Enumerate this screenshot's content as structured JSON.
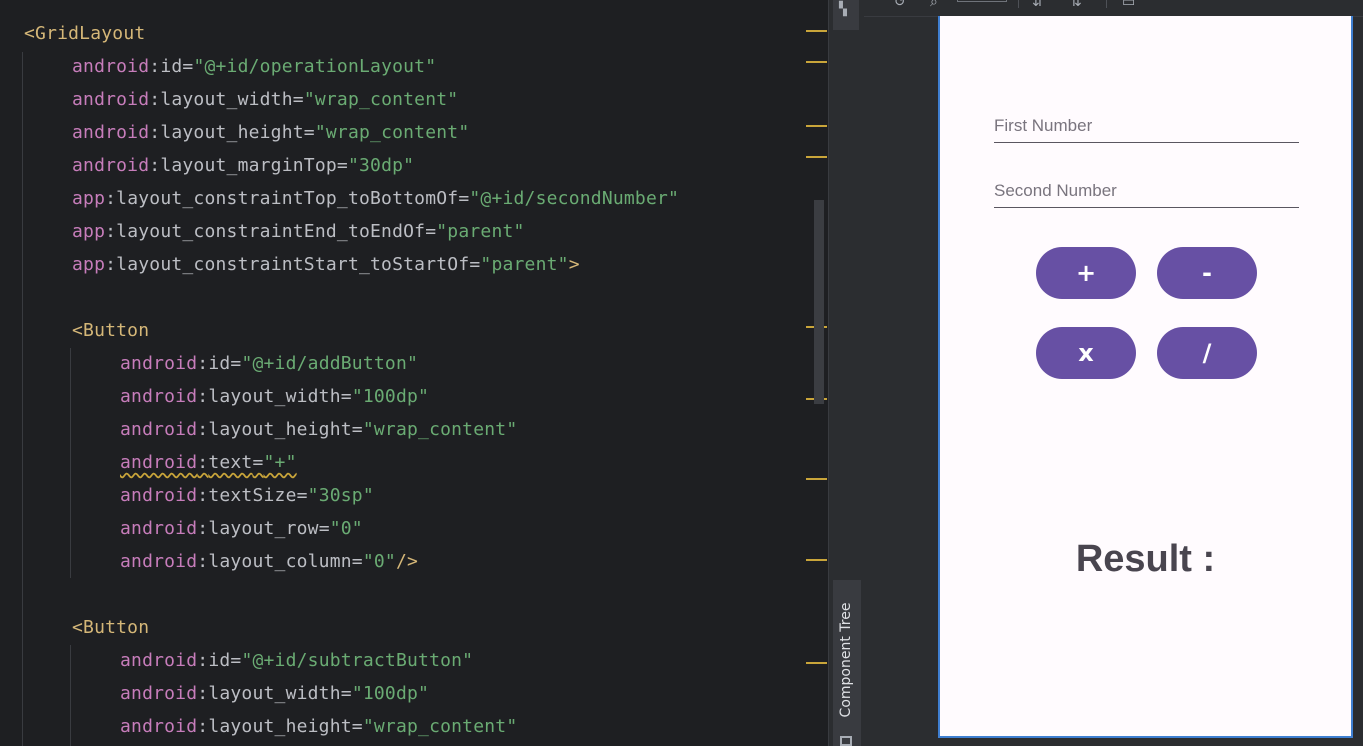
{
  "editor": {
    "lines": [
      [
        [
          "tag",
          "<GridLayout"
        ]
      ],
      [
        [
          "ns",
          "android"
        ],
        [
          "punct",
          ":"
        ],
        [
          "attr",
          "id"
        ],
        [
          "punct",
          "="
        ],
        [
          "val",
          "\"@+id/operationLayout\""
        ]
      ],
      [
        [
          "ns",
          "android"
        ],
        [
          "punct",
          ":"
        ],
        [
          "attr",
          "layout_width"
        ],
        [
          "punct",
          "="
        ],
        [
          "val",
          "\"wrap_content\""
        ]
      ],
      [
        [
          "ns",
          "android"
        ],
        [
          "punct",
          ":"
        ],
        [
          "attr",
          "layout_height"
        ],
        [
          "punct",
          "="
        ],
        [
          "val",
          "\"wrap_content\""
        ]
      ],
      [
        [
          "ns",
          "android"
        ],
        [
          "punct",
          ":"
        ],
        [
          "attr",
          "layout_marginTop"
        ],
        [
          "punct",
          "="
        ],
        [
          "val",
          "\"30dp\""
        ]
      ],
      [
        [
          "ns",
          "app"
        ],
        [
          "punct",
          ":"
        ],
        [
          "attr",
          "layout_constraintTop_toBottomOf"
        ],
        [
          "punct",
          "="
        ],
        [
          "val",
          "\"@+id/secondNumber\""
        ]
      ],
      [
        [
          "ns",
          "app"
        ],
        [
          "punct",
          ":"
        ],
        [
          "attr",
          "layout_constraintEnd_toEndOf"
        ],
        [
          "punct",
          "="
        ],
        [
          "val",
          "\"parent\""
        ]
      ],
      [
        [
          "ns",
          "app"
        ],
        [
          "punct",
          ":"
        ],
        [
          "attr",
          "layout_constraintStart_toStartOf"
        ],
        [
          "punct",
          "="
        ],
        [
          "val",
          "\"parent\""
        ],
        [
          "tag",
          ">"
        ]
      ],
      [],
      [
        [
          "tag",
          "<Button"
        ]
      ],
      [
        [
          "ns",
          "android"
        ],
        [
          "punct",
          ":"
        ],
        [
          "attr",
          "id"
        ],
        [
          "punct",
          "="
        ],
        [
          "val",
          "\"@+id/addButton\""
        ]
      ],
      [
        [
          "ns",
          "android"
        ],
        [
          "punct",
          ":"
        ],
        [
          "attr",
          "layout_width"
        ],
        [
          "punct",
          "="
        ],
        [
          "val",
          "\"100dp\""
        ]
      ],
      [
        [
          "ns",
          "android"
        ],
        [
          "punct",
          ":"
        ],
        [
          "attr",
          "layout_height"
        ],
        [
          "punct",
          "="
        ],
        [
          "val",
          "\"wrap_content\""
        ]
      ],
      [
        [
          "nsw",
          "android"
        ],
        [
          "punctw",
          ":"
        ],
        [
          "attrw",
          "text"
        ],
        [
          "punctw",
          "="
        ],
        [
          "valw",
          "\"+\""
        ]
      ],
      [
        [
          "ns",
          "android"
        ],
        [
          "punct",
          ":"
        ],
        [
          "attr",
          "textSize"
        ],
        [
          "punct",
          "="
        ],
        [
          "val",
          "\"30sp\""
        ]
      ],
      [
        [
          "ns",
          "android"
        ],
        [
          "punct",
          ":"
        ],
        [
          "attr",
          "layout_row"
        ],
        [
          "punct",
          "="
        ],
        [
          "val",
          "\"0\""
        ]
      ],
      [
        [
          "ns",
          "android"
        ],
        [
          "punct",
          ":"
        ],
        [
          "attr",
          "layout_column"
        ],
        [
          "punct",
          "="
        ],
        [
          "val",
          "\"0\""
        ],
        [
          "tag",
          "/>"
        ]
      ],
      [],
      [
        [
          "tag",
          "<Button"
        ]
      ],
      [
        [
          "ns",
          "android"
        ],
        [
          "punct",
          ":"
        ],
        [
          "attr",
          "id"
        ],
        [
          "punct",
          "="
        ],
        [
          "val",
          "\"@+id/subtractButton\""
        ]
      ],
      [
        [
          "ns",
          "android"
        ],
        [
          "punct",
          ":"
        ],
        [
          "attr",
          "layout_width"
        ],
        [
          "punct",
          "="
        ],
        [
          "val",
          "\"100dp\""
        ]
      ],
      [
        [
          "ns",
          "android"
        ],
        [
          "punct",
          ":"
        ],
        [
          "attr",
          "layout_height"
        ],
        [
          "punct",
          "="
        ],
        [
          "val",
          "\"wrap_content\""
        ]
      ]
    ]
  },
  "side_panel": {
    "component_tree_label": "Component Tree"
  },
  "preview": {
    "first_number_placeholder": "First Number",
    "second_number_placeholder": "Second Number",
    "buttons": {
      "add": "+",
      "subtract": "-",
      "multiply": "x",
      "divide": "/"
    },
    "result_label": "Result :",
    "colors": {
      "button_bg": "#6750a4",
      "selection_border": "#3f7fd1"
    }
  },
  "colors": {
    "tag": "#d5b778",
    "namespace": "#c77dbb",
    "value": "#6aab73",
    "warning_marker": "#c9a53a"
  }
}
